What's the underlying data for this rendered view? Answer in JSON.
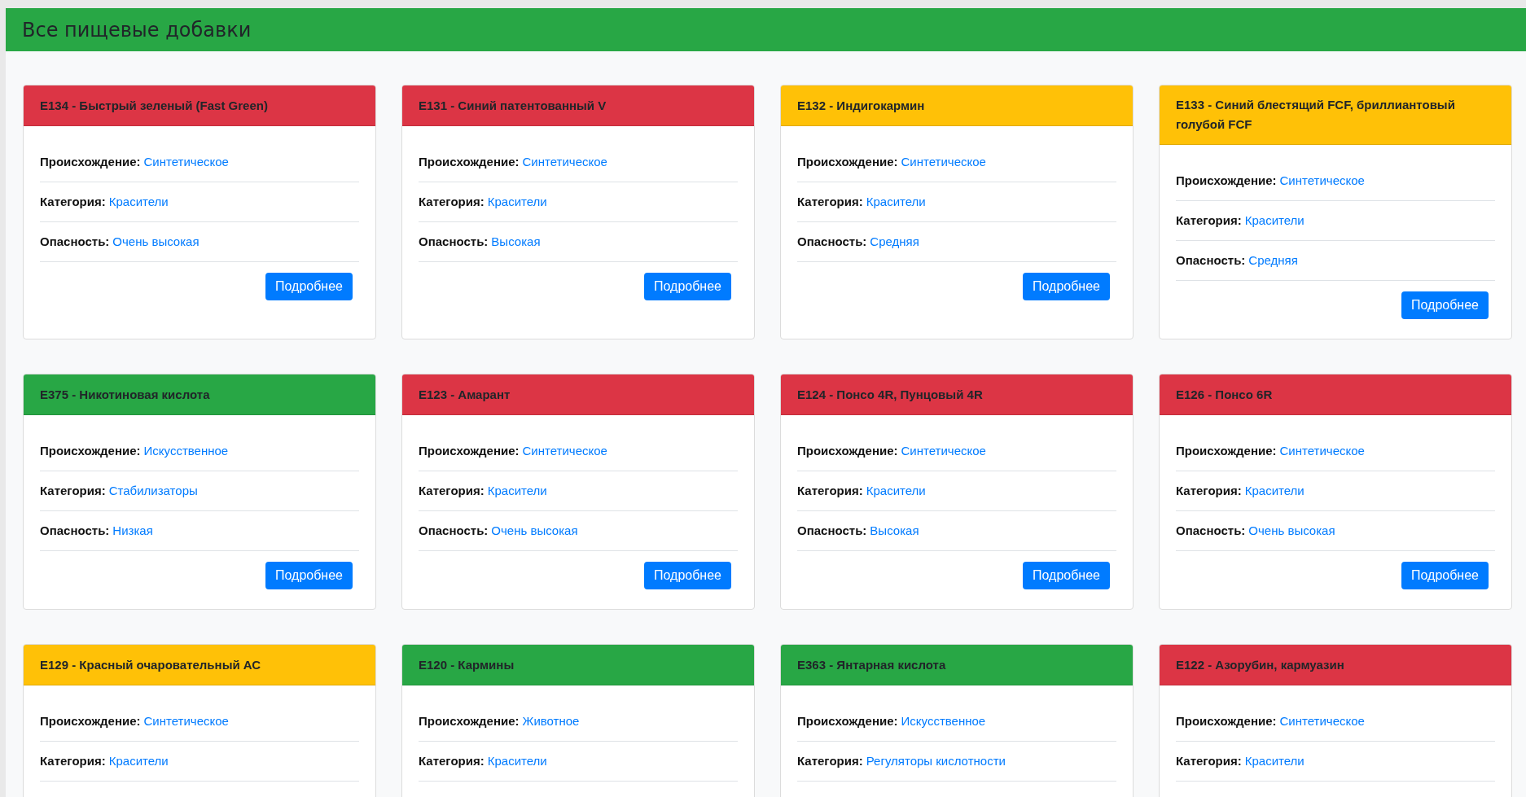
{
  "header": {
    "title": "Все пищевые добавки"
  },
  "cards": [
    {
      "title": "E134 - Быстрый зеленый (Fast Green)",
      "color": "#dc3545",
      "fields": [
        {
          "label": "Происхождение:",
          "value": "Синтетическое"
        },
        {
          "label": "Категория:",
          "value": "Красители"
        },
        {
          "label": "Опасность:",
          "value": "Очень высокая"
        }
      ],
      "button": "Подробнее"
    },
    {
      "title": "E131 - Синий патентованный V",
      "color": "#dc3545",
      "fields": [
        {
          "label": "Происхождение:",
          "value": "Синтетическое"
        },
        {
          "label": "Категория:",
          "value": "Красители"
        },
        {
          "label": "Опасность:",
          "value": "Высокая"
        }
      ],
      "button": "Подробнее"
    },
    {
      "title": "E132 - Индигокармин",
      "color": "#ffc107",
      "fields": [
        {
          "label": "Происхождение:",
          "value": "Синтетическое"
        },
        {
          "label": "Категория:",
          "value": "Красители"
        },
        {
          "label": "Опасность:",
          "value": "Средняя"
        }
      ],
      "button": "Подробнее"
    },
    {
      "title": "E133 - Синий блестящий FCF, бриллиантовый голубой FCF",
      "color": "#ffc107",
      "fields": [
        {
          "label": "Происхождение:",
          "value": "Синтетическое"
        },
        {
          "label": "Категория:",
          "value": "Красители"
        },
        {
          "label": "Опасность:",
          "value": "Средняя"
        }
      ],
      "button": "Подробнее"
    },
    {
      "title": "E375 - Никотиновая кислота",
      "color": "#28a745",
      "fields": [
        {
          "label": "Происхождение:",
          "value": "Искусственное"
        },
        {
          "label": "Категория:",
          "value": "Стабилизаторы"
        },
        {
          "label": "Опасность:",
          "value": "Низкая"
        }
      ],
      "button": "Подробнее"
    },
    {
      "title": "E123 - Амарант",
      "color": "#dc3545",
      "fields": [
        {
          "label": "Происхождение:",
          "value": "Синтетическое"
        },
        {
          "label": "Категория:",
          "value": "Красители"
        },
        {
          "label": "Опасность:",
          "value": "Очень высокая"
        }
      ],
      "button": "Подробнее"
    },
    {
      "title": "E124 - Понсо 4R, Пунцовый 4R",
      "color": "#dc3545",
      "fields": [
        {
          "label": "Происхождение:",
          "value": "Синтетическое"
        },
        {
          "label": "Категория:",
          "value": "Красители"
        },
        {
          "label": "Опасность:",
          "value": "Высокая"
        }
      ],
      "button": "Подробнее"
    },
    {
      "title": "E126 - Понсо 6R",
      "color": "#dc3545",
      "fields": [
        {
          "label": "Происхождение:",
          "value": "Синтетическое"
        },
        {
          "label": "Категория:",
          "value": "Красители"
        },
        {
          "label": "Опасность:",
          "value": "Очень высокая"
        }
      ],
      "button": "Подробнее"
    },
    {
      "title": "E129 - Красный очаровательный АС",
      "color": "#ffc107",
      "fields": [
        {
          "label": "Происхождение:",
          "value": "Синтетическое"
        },
        {
          "label": "Категория:",
          "value": "Красители"
        }
      ]
    },
    {
      "title": "E120 - Кармины",
      "color": "#28a745",
      "fields": [
        {
          "label": "Происхождение:",
          "value": "Животное"
        },
        {
          "label": "Категория:",
          "value": "Красители"
        }
      ]
    },
    {
      "title": "E363 - Янтарная кислота",
      "color": "#28a745",
      "fields": [
        {
          "label": "Происхождение:",
          "value": "Искусственное"
        },
        {
          "label": "Категория:",
          "value": "Регуляторы кислотности"
        }
      ]
    },
    {
      "title": "E122 - Азорубин, кармуазин",
      "color": "#dc3545",
      "fields": [
        {
          "label": "Происхождение:",
          "value": "Синтетическое"
        },
        {
          "label": "Категория:",
          "value": "Красители"
        }
      ]
    }
  ]
}
